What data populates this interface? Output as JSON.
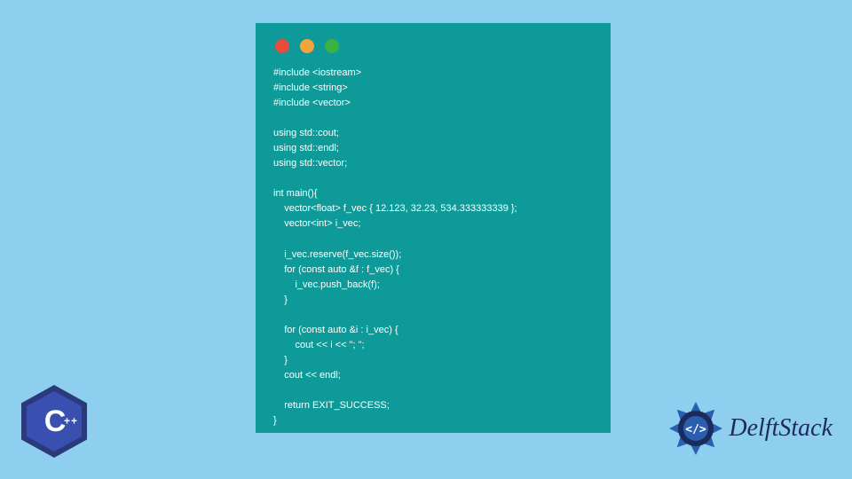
{
  "window": {
    "traffic_lights": {
      "red": "#e94b3c",
      "yellow": "#f2a53a",
      "green": "#3bb143"
    },
    "bg": "#0e9a98"
  },
  "code": {
    "lines": "#include <iostream>\n#include <string>\n#include <vector>\n\nusing std::cout;\nusing std::endl;\nusing std::vector;\n\nint main(){\n    vector<float> f_vec { 12.123, 32.23, 534.333333339 };\n    vector<int> i_vec;\n\n    i_vec.reserve(f_vec.size());\n    for (const auto &f : f_vec) {\n        i_vec.push_back(f);\n    }\n\n    for (const auto &i : i_vec) {\n        cout << i << \"; \";\n    }\n    cout << endl;\n\n    return EXIT_SUCCESS;\n}"
  },
  "badges": {
    "cpp_letter": "C",
    "cpp_plus": "++",
    "delft_text": "DelftStack"
  },
  "colors": {
    "page_bg": "#8ecff0",
    "code_fg": "#ffffff",
    "badge_dark": "#2a3a7a",
    "badge_light": "#3a50b0",
    "delft_blue": "#1a2b5c",
    "delft_accent": "#2a5fb0"
  }
}
